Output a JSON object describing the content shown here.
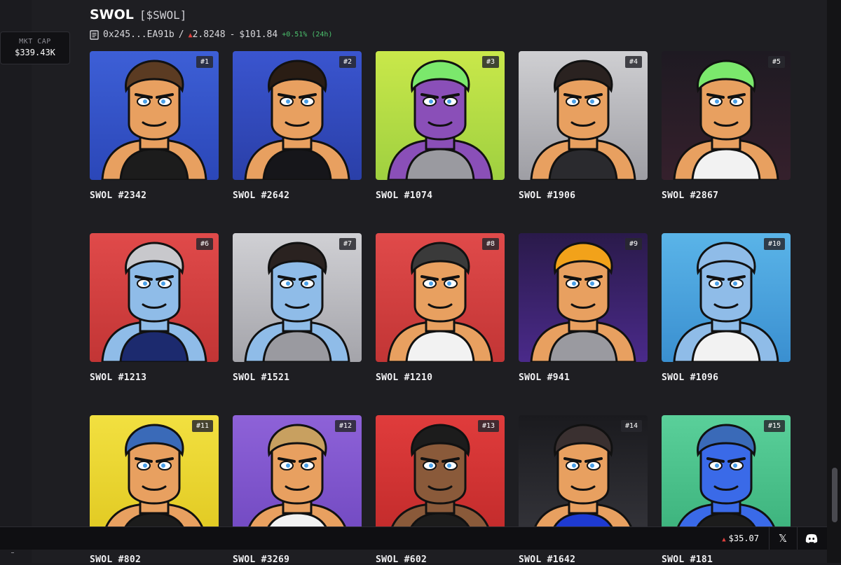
{
  "token": {
    "name": "SWOL",
    "ticker": "[$SWOL]",
    "address": "0x245...EA91b",
    "separator": "/",
    "eth_price": "2.8248",
    "dash": "-",
    "usd_price": "$101.84",
    "change": "+0.51% (24h)"
  },
  "market_cap": {
    "label": "MKT CAP",
    "value": "$339.43K"
  },
  "footer": {
    "price": "$35.07",
    "x_label": "𝕏"
  },
  "colors": {
    "up": "#e0403d",
    "positive": "#4cc36e",
    "background": "#1e1e22"
  },
  "cards": [
    {
      "rank": "#1",
      "name": "SWOL #2342",
      "bg": "#3d5fd6",
      "bg2": "#2b47b8",
      "skin": "#e8a060",
      "hair": "#5b3b22",
      "shirt": "#1c1c1c"
    },
    {
      "rank": "#2",
      "name": "SWOL #2642",
      "bg": "#3a55cf",
      "bg2": "#2a3fa8",
      "skin": "#e8a060",
      "hair": "#2a1d14",
      "shirt": "#16161a"
    },
    {
      "rank": "#3",
      "name": "SWOL #1074",
      "bg": "#c9e84a",
      "bg2": "#9fd040",
      "skin": "#8a4fb8",
      "hair": "#7be86c",
      "shirt": "#9a9aa0"
    },
    {
      "rank": "#4",
      "name": "SWOL #1906",
      "bg": "#cfcfd2",
      "bg2": "#9e9ea4",
      "skin": "#e8a060",
      "hair": "#2a2220",
      "shirt": "#2a2a2e"
    },
    {
      "rank": "#5",
      "name": "SWOL #2867",
      "bg": "#1e1a22",
      "bg2": "#35202c",
      "skin": "#e8a060",
      "hair": "#7be86c",
      "shirt": "#f2f2f2"
    },
    {
      "rank": "#6",
      "name": "SWOL #1213",
      "bg": "#e04a4a",
      "bg2": "#c23535",
      "skin": "#8fbce8",
      "hair": "#c8c8cc",
      "shirt": "#1c2a6e"
    },
    {
      "rank": "#7",
      "name": "SWOL #1521",
      "bg": "#d0d0d4",
      "bg2": "#a4a4aa",
      "skin": "#8fbce8",
      "hair": "#2a2220",
      "shirt": "#9a9aa0"
    },
    {
      "rank": "#8",
      "name": "SWOL #1210",
      "bg": "#e04a4a",
      "bg2": "#c23535",
      "skin": "#e8a060",
      "hair": "#3a3a3a",
      "shirt": "#f2f2f2"
    },
    {
      "rank": "#9",
      "name": "SWOL #941",
      "bg": "#2a1a4a",
      "bg2": "#4a2a8a",
      "skin": "#e8a060",
      "hair": "#f2a21a",
      "shirt": "#9a9aa0"
    },
    {
      "rank": "#10",
      "name": "SWOL #1096",
      "bg": "#5ab4e8",
      "bg2": "#3a8fd0",
      "skin": "#8fbce8",
      "hair": "#8fbce8",
      "shirt": "#f2f2f2"
    },
    {
      "rank": "#11",
      "name": "SWOL #802",
      "bg": "#f2e040",
      "bg2": "#e0c820",
      "skin": "#e8a060",
      "hair": "#3a6ab8",
      "shirt": "#1c1c1c"
    },
    {
      "rank": "#12",
      "name": "SWOL #3269",
      "bg": "#8e62d8",
      "bg2": "#7048c0",
      "skin": "#e8a060",
      "hair": "#c8a060",
      "shirt": "#f2f2f2"
    },
    {
      "rank": "#13",
      "name": "SWOL #602",
      "bg": "#e03c3c",
      "bg2": "#c02a2a",
      "skin": "#8a5a3a",
      "hair": "#1c1c1c",
      "shirt": "#1c1c1c"
    },
    {
      "rank": "#14",
      "name": "SWOL #1642",
      "bg": "#1a1a1e",
      "bg2": "#36363c",
      "skin": "#e8a060",
      "hair": "#3a3030",
      "shirt": "#1e3ad0"
    },
    {
      "rank": "#15",
      "name": "SWOL #181",
      "bg": "#5ad09a",
      "bg2": "#3ab07a",
      "skin": "#3a6ae8",
      "hair": "#3a6ab8",
      "shirt": "#1c1c1c"
    }
  ]
}
